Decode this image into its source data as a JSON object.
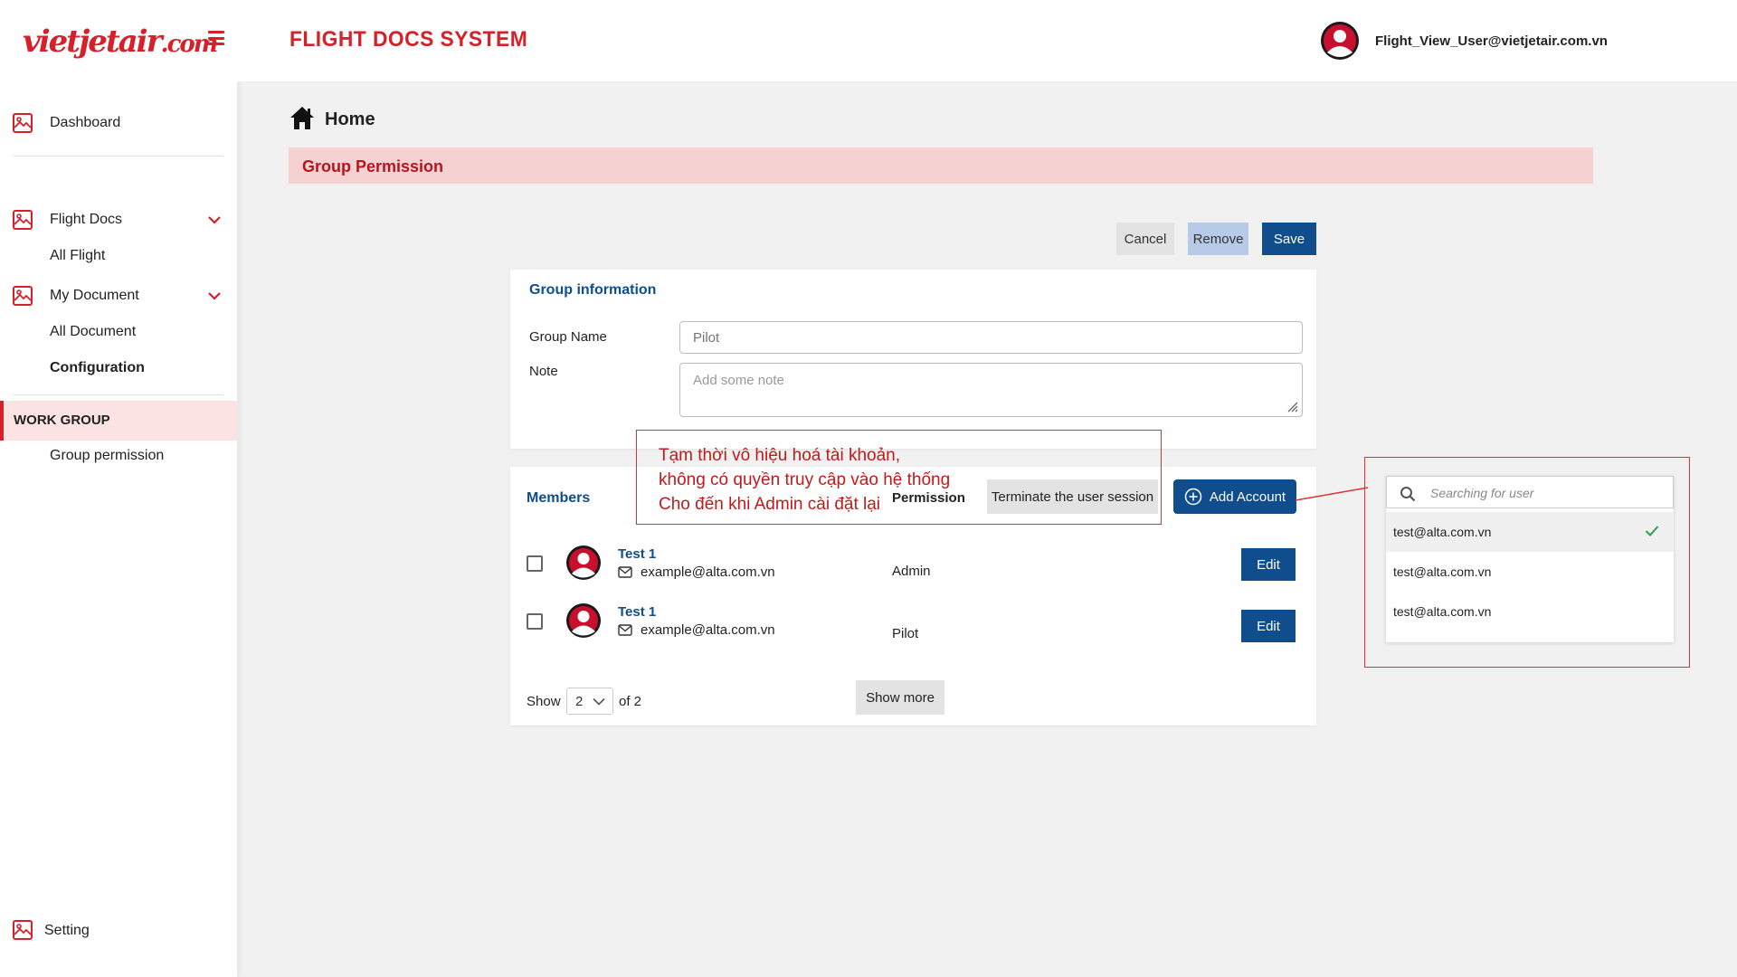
{
  "brand": {
    "logo_main": "vietjetair",
    "logo_suffix": ".com"
  },
  "header": {
    "system_title": "FLIGHT DOCS SYSTEM",
    "user_email": "Flight_View_User@vietjetair.com.vn"
  },
  "sidebar": {
    "dashboard": "Dashboard",
    "flight_docs": "Flight Docs",
    "all_flight": "All Flight",
    "my_document": "My Document",
    "all_document": "All Document",
    "configuration": "Configuration",
    "work_group": "WORK GROUP",
    "group_permission": "Group permission",
    "setting": "Setting"
  },
  "breadcrumb": {
    "home": "Home"
  },
  "banner": {
    "title": "Group Permission"
  },
  "actions": {
    "cancel": "Cancel",
    "remove": "Remove",
    "save": "Save"
  },
  "group_info": {
    "title": "Group information",
    "name_label": "Group Name",
    "name_placeholder": "Pilot",
    "note_label": "Note",
    "note_placeholder": "Add some note"
  },
  "members": {
    "title": "Members",
    "permission_header": "Permission",
    "terminate_label": "Terminate the user session",
    "add_account_label": "Add Account",
    "rows": [
      {
        "name": "Test 1",
        "email": "example@alta.com.vn",
        "permission": "Admin",
        "edit": "Edit"
      },
      {
        "name": "Test 1",
        "email": "example@alta.com.vn",
        "permission": "Pilot",
        "edit": "Edit"
      }
    ],
    "show_label": "Show",
    "show_value": "2",
    "of_label": "of 2",
    "show_more": "Show more"
  },
  "annotation": {
    "line1": "Tạm thời vô hiệu hoá tài khoản,",
    "line2": "không có quyền truy cập vào hệ thống",
    "line3": "Cho đến khi Admin cài đặt lại"
  },
  "user_search": {
    "placeholder": "Searching for user",
    "results": [
      "test@alta.com.vn",
      "test@alta.com.vn",
      "test@alta.com.vn"
    ]
  },
  "colors": {
    "brand_red": "#d6202a",
    "primary_blue": "#0f4d8c",
    "banner_pink": "#f6d1d2"
  }
}
